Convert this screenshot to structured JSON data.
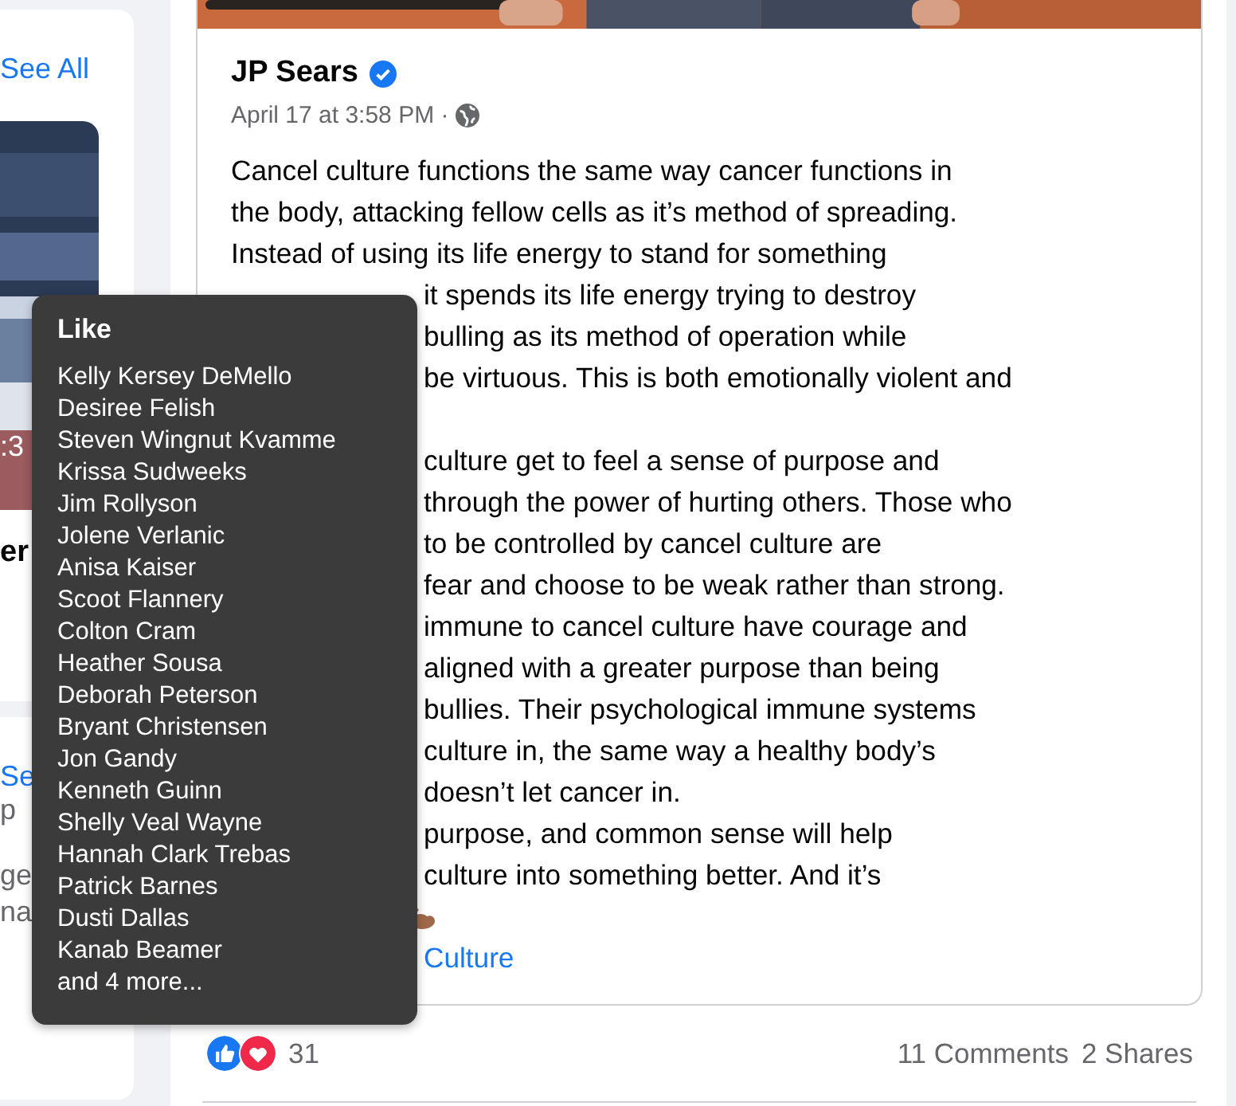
{
  "sidebar": {
    "cards": [
      {
        "link": "See All",
        "video": {
          "kind": "picture",
          "duration": ":3"
        },
        "title": "er"
      },
      {
        "link": "Se",
        "lines": [
          "p",
          "ge",
          "na"
        ]
      }
    ]
  },
  "post": {
    "author": "JP Sears",
    "verified": true,
    "timestamp": "April 17 at 3:58 PM ·",
    "lines_above_tooltip": [
      "Cancel culture functions the same way cancer functions in",
      "the body, attacking fellow cells as it’s method of spreading.",
      "Instead of using its life energy to stand for something"
    ],
    "lines_beside_tooltip": [
      [
        "it spends its life energy  trying to destroy",
        "bulling as its method of operation while",
        "be virtuous. This is both emotionally violent and"
      ],
      [
        "culture get to feel a sense of purpose and",
        "through the power of hurting others. Those who",
        "to be controlled by cancel culture are",
        "fear and choose to be weak rather than strong.",
        "immune to cancel culture have courage and",
        "aligned with a greater purpose than being",
        "bullies. Their psychological immune systems",
        "culture in, the same way a healthy body’s",
        "doesn’t let cancer in.",
        "purpose, and common sense will help",
        "culture into something better. And it’s"
      ]
    ],
    "hashtag": "Culture",
    "reactions": [
      {
        "kind": "like"
      },
      {
        "kind": "love"
      }
    ],
    "reaction_count": "31",
    "comments": "11 Comments",
    "shares": "2 Shares"
  },
  "tooltip": {
    "title": "Like",
    "names": [
      "Kelly Kersey DeMello",
      "Desiree Felish",
      "Steven Wingnut Kvamme",
      "Krissa Sudweeks",
      "Jim Rollyson",
      "Jolene Verlanic",
      "Anisa Kaiser",
      "Scoot Flannery",
      "Colton Cram",
      "Heather Sousa",
      "Deborah Peterson",
      "Bryant Christensen",
      "Jon Gandy",
      "Kenneth Guinn",
      "Shelly Veal Wayne",
      "Hannah Clark Trebas",
      "Patrick Barnes",
      "Dusti Dallas",
      "Kanab Beamer"
    ],
    "more": "and 4 more..."
  }
}
